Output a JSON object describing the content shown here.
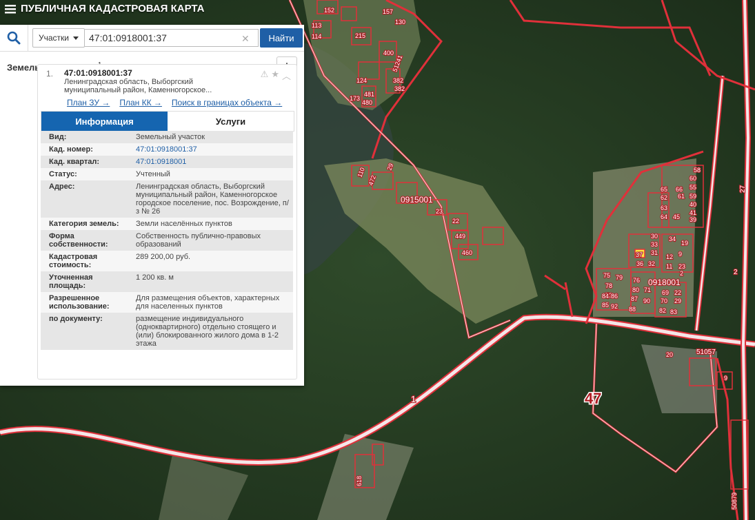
{
  "app": {
    "title": "ПУБЛИЧНАЯ КАДАСТРОВАЯ КАРТА"
  },
  "search": {
    "type": "Участки",
    "query": "47:01:0918001:37",
    "button": "Найти"
  },
  "results": {
    "title": "Земельные участки",
    "count": "1",
    "item": {
      "index": "1.",
      "cadnum": "47:01:0918001:37",
      "address_line1": "Ленинградская область, Выборгский",
      "address_line2": "муниципальный район, Каменногорское...",
      "links": [
        "План ЗУ →",
        "План КК →",
        "Поиск в границах объекта →"
      ],
      "tabs": [
        "Информация",
        "Услуги"
      ],
      "info": [
        {
          "k": "Вид:",
          "v": "Земельный участок"
        },
        {
          "k": "Кад. номер:",
          "v": "47:01:0918001:37"
        },
        {
          "k": "Кад. квартал:",
          "v": "47:01:0918001"
        },
        {
          "k": "Статус:",
          "v": "Учтенный"
        },
        {
          "k": "Адрес:",
          "v": "Ленинградская область, Выборгский муниципальный район, Каменногорское городское поселение, пос. Возрождение, п/з № 26"
        },
        {
          "k": "Категория земель:",
          "v": "Земли населённых пунктов"
        },
        {
          "k": "Форма собственности:",
          "v": "Собственность публично-правовых образований"
        },
        {
          "k": "Кадастровая стоимость:",
          "v": "289 200,00 руб."
        },
        {
          "k": "Уточненная площадь:",
          "v": "1 200 кв. м"
        },
        {
          "k": "Разрешенное использование:",
          "v": "Для размещения объектов, характерных для населенных пунктов"
        },
        {
          "k": "по документу:",
          "v": "размещение индивидуального (одноквартирного) отдельно стоящего и (или) блокированного жилого дома в 1-2 этажа"
        }
      ]
    }
  },
  "map": {
    "quarters": [
      "0915001",
      "0918001"
    ],
    "road_labels": [
      "1",
      "47",
      "51057",
      "50879",
      "2",
      "27"
    ],
    "parcel_labels": [
      "152",
      "113",
      "114",
      "215",
      "157",
      "130",
      "400",
      "51241",
      "124",
      "382",
      "382",
      "173",
      "481",
      "480",
      "110",
      "472",
      "29",
      "23",
      "22",
      "449",
      "460",
      "618",
      "58",
      "60",
      "55",
      "59",
      "40",
      "41",
      "45",
      "39",
      "61",
      "62",
      "63",
      "64",
      "65",
      "66",
      "34",
      "19",
      "30",
      "33",
      "31",
      "37",
      "36",
      "32",
      "12",
      "11",
      "23",
      "9",
      "2",
      "76",
      "75",
      "79",
      "80",
      "71",
      "78",
      "73",
      "84",
      "86",
      "87",
      "90",
      "85",
      "92",
      "88",
      "69",
      "22",
      "70",
      "29",
      "82",
      "83",
      "20",
      "9"
    ],
    "colors": {
      "boundary": "#e0303a",
      "road": "#f4e6e8",
      "forest": "#22371f",
      "meadow": "#7c8f62",
      "water": "#3b4a44",
      "selected": "#ffe640"
    }
  }
}
